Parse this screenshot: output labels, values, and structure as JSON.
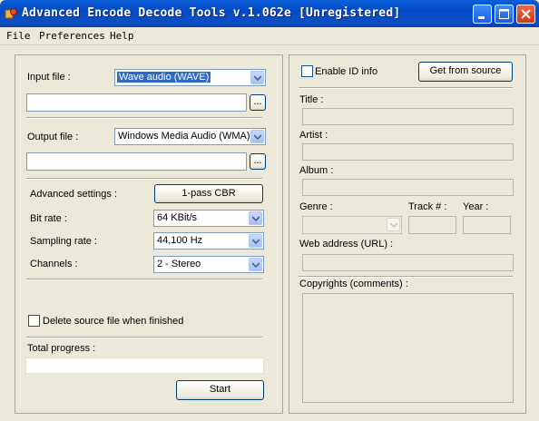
{
  "window": {
    "title": "Advanced Encode Decode Tools v.1.062e [Unregistered]"
  },
  "menu": [
    "File",
    "Preferences",
    "Help"
  ],
  "left": {
    "input_file_label": "Input file :",
    "input_format": "Wave audio (WAVE)",
    "input_path": "",
    "browse_label": "...",
    "output_file_label": "Output file :",
    "output_format": "Windows Media Audio (WMA)",
    "output_path": "",
    "advanced_label": "Advanced settings :",
    "advanced_button": "1-pass CBR",
    "bitrate_label": "Bit rate :",
    "bitrate_value": "64 KBit/s",
    "sampling_label": "Sampling rate :",
    "sampling_value": "44,100 Hz",
    "channels_label": "Channels :",
    "channels_value": "2 - Stereo",
    "delete_label": "Delete source file when finished",
    "delete_checked": false,
    "progress_label": "Total progress :",
    "progress_value": 0,
    "start_button": "Start"
  },
  "right": {
    "enable_id_label": "Enable ID info",
    "enable_id_checked": false,
    "get_source_button": "Get from source",
    "title_label": "Title :",
    "artist_label": "Artist :",
    "album_label": "Album :",
    "genre_label": "Genre :",
    "track_label": "Track # :",
    "year_label": "Year :",
    "web_label": "Web address (URL) :",
    "copyrights_label": "Copyrights (comments) :"
  },
  "colors": {
    "titlebar": "#0a5fd8",
    "window_bg": "#ece9d8",
    "selection": "#316ac5"
  }
}
